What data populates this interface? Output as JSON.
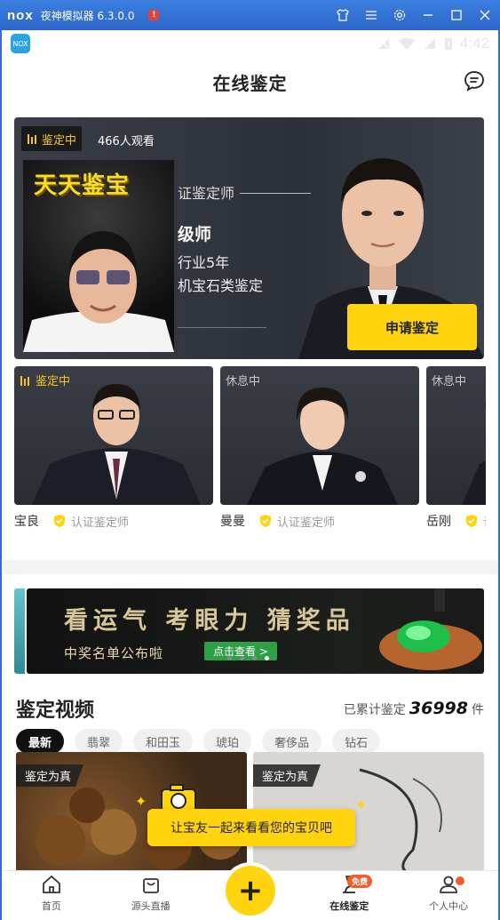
{
  "emulator": {
    "logo": "nox",
    "title": "夜神模拟器 6.3.0.0",
    "warn": "!"
  },
  "statusbar": {
    "app_icon_text": "NOX",
    "time": "4:42"
  },
  "header": {
    "title": "在线鉴定"
  },
  "banner": {
    "badge": "鉴定中",
    "viewers": "466人观看",
    "pip_text": "天天鉴宝",
    "line1": "证鉴定师",
    "line2": "级师",
    "line3": "行业5年",
    "line4": "机宝石类鉴定",
    "apply_button": "申请鉴定"
  },
  "appraisers": [
    {
      "status": "鉴定中",
      "name": "宝良",
      "cert": "认证鉴定师"
    },
    {
      "status": "休息中",
      "name": "曼曼",
      "cert": "认证鉴定师"
    },
    {
      "status": "休息中",
      "name": "岳刚",
      "cert": "认"
    }
  ],
  "promo": {
    "title": "看运气 考眼力 猜奖品",
    "subtitle": "中奖名单公布啦",
    "button": "点击查看 >"
  },
  "videos_section": {
    "title": "鉴定视频",
    "count_prefix": "已累计鉴定",
    "count": "36998",
    "count_suffix": "件",
    "tabs": [
      "最新",
      "翡翠",
      "和田玉",
      "琥珀",
      "奢侈品",
      "钻石"
    ],
    "active_tab": "最新",
    "items": [
      {
        "tag": "鉴定为真"
      },
      {
        "tag": "鉴定为真"
      }
    ],
    "tip": "让宝友一起来看看您的宝贝吧"
  },
  "tabbar": {
    "items": [
      {
        "label": "首页"
      },
      {
        "label": "源头直播"
      },
      {
        "label": "在线鉴定",
        "badge": "免费"
      },
      {
        "label": "个人中心"
      }
    ],
    "plus": "+"
  },
  "colors": {
    "accent": "#ffd30e",
    "emulator_bar": "#2f6fd0",
    "live": "#f5c61f",
    "badge": "#f35c2b"
  }
}
